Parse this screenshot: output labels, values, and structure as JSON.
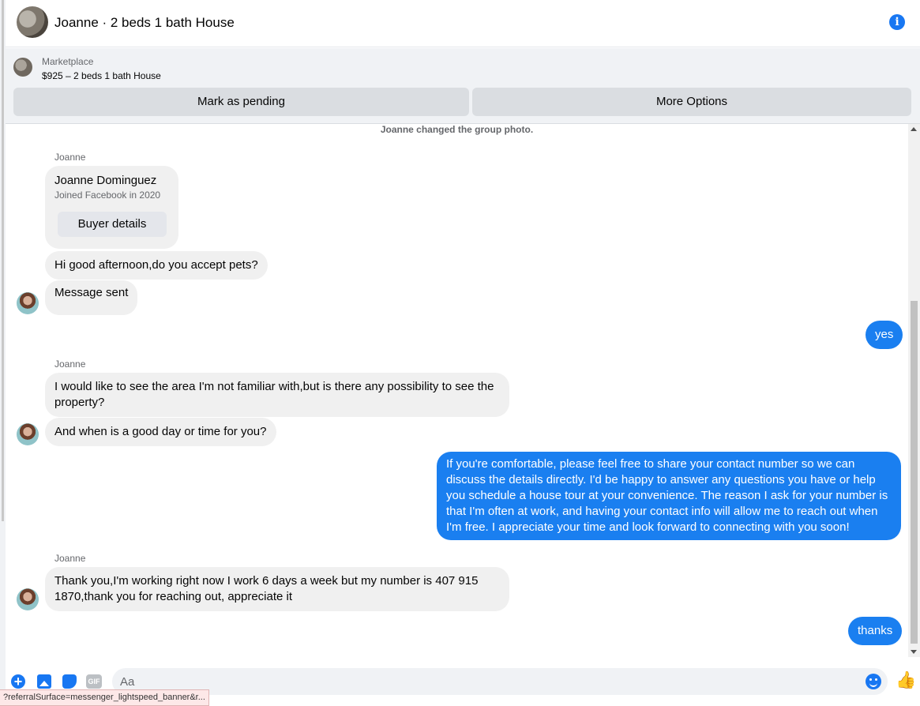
{
  "header": {
    "title": "Joanne · 2 beds 1 bath House",
    "info_icon": "info-icon"
  },
  "banner": {
    "label": "Marketplace",
    "listing": "$925 – 2 beds 1 bath House",
    "pending_label": "Mark as pending",
    "more_label": "More Options"
  },
  "chat": {
    "system_message": "Joanne changed the group photo.",
    "sender_name": "Joanne",
    "card": {
      "name": "Joanne Dominguez",
      "joined": "Joined Facebook in 2020",
      "button_label": "Buyer details"
    },
    "messages": [
      {
        "from": "Joanne",
        "text": "Hi good afternoon,do you accept pets?"
      },
      {
        "from": "Joanne",
        "text": "Message sent"
      },
      {
        "from": "me",
        "text": "yes"
      },
      {
        "from": "Joanne",
        "text": "I would like to see the area I'm not familiar with,but is there any possibility to see the property?"
      },
      {
        "from": "Joanne",
        "text": "And when is a good day or time for you?"
      },
      {
        "from": "me",
        "text": "If you're comfortable, please feel free to share your contact number so we can discuss the details directly. I'd be happy to answer any questions you have or help you schedule a house tour at your convenience. The reason I ask for your number is that I'm often at work, and having your contact info will allow me to reach out when I'm free. I appreciate your time and look forward to connecting with you soon!"
      },
      {
        "from": "Joanne",
        "text": "Thank you,I'm working right now I work 6 days a week but my number is 407 915 1870,thank you for reaching out, appreciate it"
      },
      {
        "from": "me",
        "text": "thanks"
      }
    ]
  },
  "composer": {
    "placeholder": "Aa",
    "gif_label": "GIF"
  },
  "status_bar": {
    "url": "?referralSurface=messenger_lightspeed_banner&r..."
  },
  "colors": {
    "accent": "#1877f2",
    "outgoing_bubble": "#1a7ff0",
    "incoming_bubble": "#f0f0f0"
  }
}
